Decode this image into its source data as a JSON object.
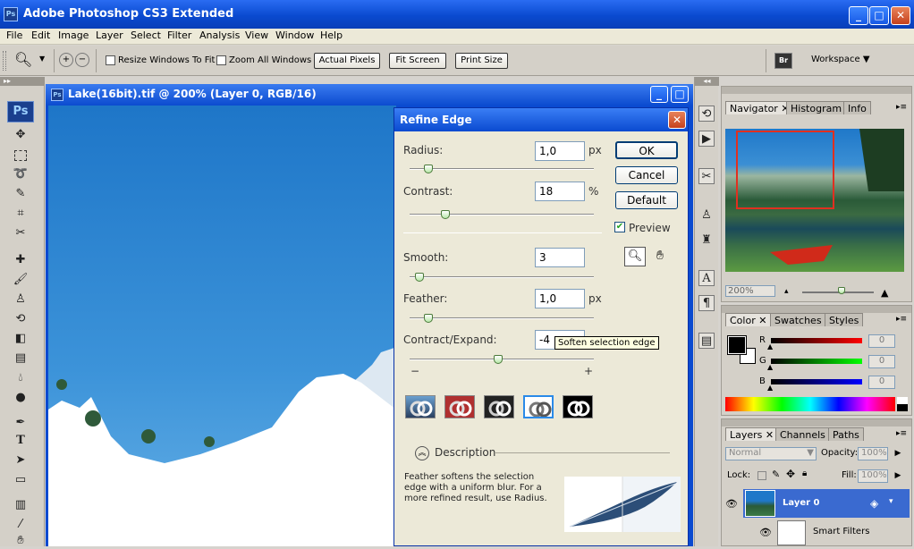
{
  "app": {
    "title": "Adobe Photoshop CS3 Extended",
    "logo": "Ps"
  },
  "menu": [
    "File",
    "Edit",
    "Image",
    "Layer",
    "Select",
    "Filter",
    "Analysis",
    "View",
    "Window",
    "Help"
  ],
  "options": {
    "resize_windows": "Resize Windows To Fit",
    "zoom_all": "Zoom All Windows",
    "actual_pixels": "Actual Pixels",
    "fit_screen": "Fit Screen",
    "print_size": "Print Size",
    "workspace": "Workspace ▼",
    "bridge_icon": "Br"
  },
  "document": {
    "title": "Lake(16bit).tif @ 200% (Layer 0, RGB/16)"
  },
  "refine_edge": {
    "title": "Refine Edge",
    "radius_label": "Radius:",
    "radius_value": "1,0",
    "radius_unit": "px",
    "contrast_label": "Contrast:",
    "contrast_value": "18",
    "contrast_unit": "%",
    "smooth_label": "Smooth:",
    "smooth_value": "3",
    "feather_label": "Feather:",
    "feather_value": "1,0",
    "feather_unit": "px",
    "contract_label": "Contract/Expand:",
    "contract_value": "-4",
    "minus": "−",
    "plus": "+",
    "tooltip": "Soften selection edge",
    "ok": "OK",
    "cancel": "Cancel",
    "default": "Default",
    "preview": "Preview",
    "description_label": "Description",
    "description_text": "Feather softens the selection edge with a uniform blur. For a more refined result, use Radius.",
    "slider_levels": {
      "radius": 0.08,
      "contrast": 0.18,
      "smooth": 0.03,
      "feather": 0.08,
      "contract": 0.48
    }
  },
  "navigator": {
    "tabs": [
      "Navigator",
      "Histogram",
      "Info"
    ],
    "zoom": "200%"
  },
  "color": {
    "tabs": [
      "Color",
      "Swatches",
      "Styles"
    ],
    "r_label": "R",
    "g_label": "G",
    "b_label": "B",
    "r": "0",
    "g": "0",
    "b": "0"
  },
  "layers": {
    "tabs": [
      "Layers",
      "Channels",
      "Paths"
    ],
    "blend_mode": "Normal",
    "opacity_label": "Opacity:",
    "opacity": "100%",
    "lock_label": "Lock:",
    "fill_label": "Fill:",
    "fill": "100%",
    "layer0": "Layer 0",
    "smart_filters": "Smart Filters"
  },
  "colors": {
    "accent": "#0a4ad0",
    "selection_red": "#e03020",
    "panel": "#d4d0c8"
  }
}
